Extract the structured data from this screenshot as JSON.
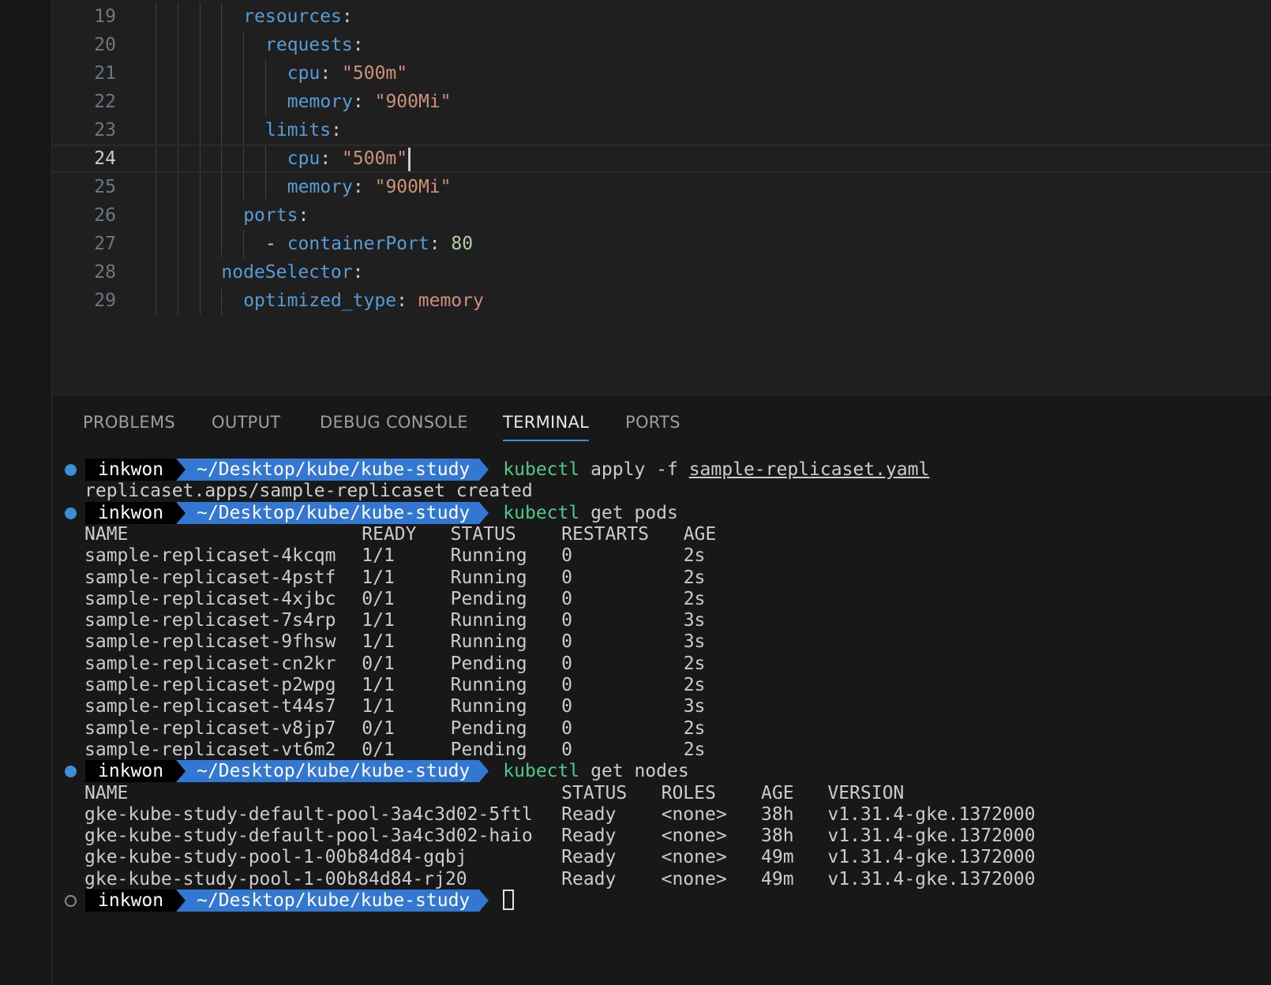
{
  "editor": {
    "lines": [
      {
        "num": "19",
        "indent": 4,
        "tokens": [
          {
            "t": "resources",
            "c": "k"
          },
          {
            "t": ":",
            "c": "p"
          }
        ]
      },
      {
        "num": "20",
        "indent": 5,
        "tokens": [
          {
            "t": "requests",
            "c": "k"
          },
          {
            "t": ":",
            "c": "p"
          }
        ]
      },
      {
        "num": "21",
        "indent": 6,
        "tokens": [
          {
            "t": "cpu",
            "c": "k"
          },
          {
            "t": ": ",
            "c": "p"
          },
          {
            "t": "\"500m\"",
            "c": "s"
          }
        ]
      },
      {
        "num": "22",
        "indent": 6,
        "tokens": [
          {
            "t": "memory",
            "c": "k"
          },
          {
            "t": ": ",
            "c": "p"
          },
          {
            "t": "\"900Mi\"",
            "c": "s"
          }
        ]
      },
      {
        "num": "23",
        "indent": 5,
        "tokens": [
          {
            "t": "limits",
            "c": "k"
          },
          {
            "t": ":",
            "c": "p"
          }
        ]
      },
      {
        "num": "24",
        "indent": 6,
        "current": true,
        "tokens": [
          {
            "t": "cpu",
            "c": "k"
          },
          {
            "t": ": ",
            "c": "p"
          },
          {
            "t": "\"500m\"",
            "c": "s"
          }
        ]
      },
      {
        "num": "25",
        "indent": 6,
        "tokens": [
          {
            "t": "memory",
            "c": "k"
          },
          {
            "t": ": ",
            "c": "p"
          },
          {
            "t": "\"900Mi\"",
            "c": "s"
          }
        ]
      },
      {
        "num": "26",
        "indent": 4,
        "tokens": [
          {
            "t": "ports",
            "c": "k"
          },
          {
            "t": ":",
            "c": "p"
          }
        ]
      },
      {
        "num": "27",
        "indent": 5,
        "tokens": [
          {
            "t": "- ",
            "c": "p"
          },
          {
            "t": "containerPort",
            "c": "k"
          },
          {
            "t": ": ",
            "c": "p"
          },
          {
            "t": "80",
            "c": "n"
          }
        ]
      },
      {
        "num": "28",
        "indent": 3,
        "tokens": [
          {
            "t": "nodeSelector",
            "c": "k"
          },
          {
            "t": ":",
            "c": "p"
          }
        ]
      },
      {
        "num": "29",
        "indent": 4,
        "tokens": [
          {
            "t": "optimized_type",
            "c": "k"
          },
          {
            "t": ": ",
            "c": "p"
          },
          {
            "t": "memory",
            "c": "s"
          }
        ]
      }
    ]
  },
  "panel": {
    "tabs": [
      {
        "label": "PROBLEMS",
        "active": false
      },
      {
        "label": "OUTPUT",
        "active": false
      },
      {
        "label": "DEBUG CONSOLE",
        "active": false
      },
      {
        "label": "TERMINAL",
        "active": true
      },
      {
        "label": "PORTS",
        "active": false
      }
    ]
  },
  "terminal": {
    "prompt_user": "inkwon",
    "prompt_path": "~/Desktop/kube/kube-study",
    "commands": [
      {
        "tool": "kubectl",
        "args": " apply -f ",
        "file": "sample-replicaset.yaml"
      },
      {
        "tool": "kubectl",
        "args": " get pods",
        "file": ""
      },
      {
        "tool": "kubectl",
        "args": " get nodes",
        "file": ""
      }
    ],
    "apply_output": "replicaset.apps/sample-replicaset created",
    "pods": {
      "headers": [
        "NAME",
        "READY",
        "STATUS",
        "RESTARTS",
        "AGE"
      ],
      "rows": [
        [
          "sample-replicaset-4kcqm",
          "1/1",
          "Running",
          "0",
          "2s"
        ],
        [
          "sample-replicaset-4pstf",
          "1/1",
          "Running",
          "0",
          "2s"
        ],
        [
          "sample-replicaset-4xjbc",
          "0/1",
          "Pending",
          "0",
          "2s"
        ],
        [
          "sample-replicaset-7s4rp",
          "1/1",
          "Running",
          "0",
          "3s"
        ],
        [
          "sample-replicaset-9fhsw",
          "1/1",
          "Running",
          "0",
          "3s"
        ],
        [
          "sample-replicaset-cn2kr",
          "0/1",
          "Pending",
          "0",
          "2s"
        ],
        [
          "sample-replicaset-p2wpg",
          "1/1",
          "Running",
          "0",
          "2s"
        ],
        [
          "sample-replicaset-t44s7",
          "1/1",
          "Running",
          "0",
          "3s"
        ],
        [
          "sample-replicaset-v8jp7",
          "0/1",
          "Pending",
          "0",
          "2s"
        ],
        [
          "sample-replicaset-vt6m2",
          "0/1",
          "Pending",
          "0",
          "2s"
        ]
      ]
    },
    "nodes": {
      "headers": [
        "NAME",
        "STATUS",
        "ROLES",
        "AGE",
        "VERSION"
      ],
      "rows": [
        [
          "gke-kube-study-default-pool-3a4c3d02-5ftl",
          "Ready",
          "<none>",
          "38h",
          "v1.31.4-gke.1372000"
        ],
        [
          "gke-kube-study-default-pool-3a4c3d02-haio",
          "Ready",
          "<none>",
          "38h",
          "v1.31.4-gke.1372000"
        ],
        [
          "gke-kube-study-pool-1-00b84d84-gqbj",
          "Ready",
          "<none>",
          "49m",
          "v1.31.4-gke.1372000"
        ],
        [
          "gke-kube-study-pool-1-00b84d84-rj20",
          "Ready",
          "<none>",
          "49m",
          "v1.31.4-gke.1372000"
        ]
      ]
    }
  }
}
